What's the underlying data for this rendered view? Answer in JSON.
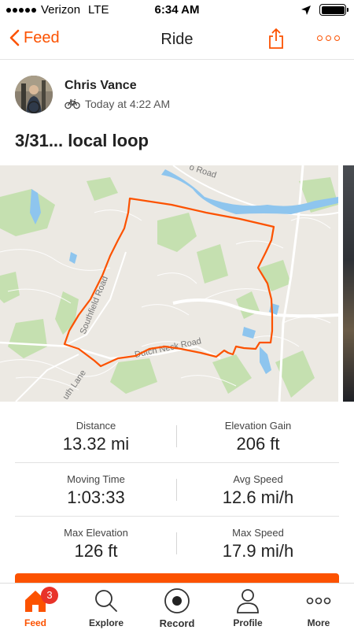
{
  "status_bar": {
    "carrier": "Verizon",
    "network": "LTE",
    "time": "6:34 AM",
    "icons": [
      "signal-dots-icon",
      "location-arrow-icon",
      "battery-icon"
    ]
  },
  "nav": {
    "back_label": "Feed",
    "title": "Ride",
    "icons": [
      "chevron-left-icon",
      "share-icon",
      "more-icon"
    ],
    "accent_color": "#fc5200"
  },
  "athlete": {
    "name": "Chris Vance",
    "timestamp": "Today at 4:22 AM",
    "activity_icon": "bike-icon"
  },
  "activity": {
    "title": "3/31... local loop"
  },
  "map": {
    "road_labels": [
      "Southfield Road",
      "Dutch Neck Road",
      "uth Lane",
      "o Road"
    ],
    "route_color": "#fc5200"
  },
  "stats": [
    {
      "left": {
        "label": "Distance",
        "value": "13.32 mi"
      },
      "right": {
        "label": "Elevation Gain",
        "value": "206 ft"
      }
    },
    {
      "left": {
        "label": "Moving Time",
        "value": "1:03:33"
      },
      "right": {
        "label": "Avg Speed",
        "value": "12.6 mi/h"
      }
    },
    {
      "left": {
        "label": "Max Elevation",
        "value": "126 ft"
      },
      "right": {
        "label": "Max Speed",
        "value": "17.9 mi/h"
      }
    }
  ],
  "tabbar": {
    "tabs": [
      {
        "label": "Feed",
        "icon": "home-icon",
        "active": true,
        "badge": "3"
      },
      {
        "label": "Explore",
        "icon": "search-icon"
      },
      {
        "label": "Record",
        "icon": "record-icon"
      },
      {
        "label": "Profile",
        "icon": "profile-icon"
      },
      {
        "label": "More",
        "icon": "more-icon"
      }
    ]
  }
}
